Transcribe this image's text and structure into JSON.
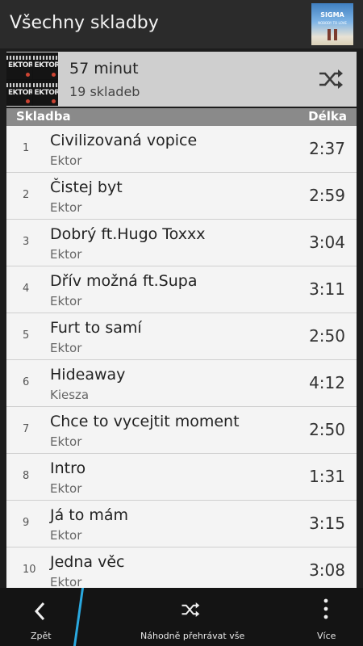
{
  "header": {
    "title": "Všechny skladby",
    "now_playing_art": {
      "brand": "SIGMA",
      "subtitle": "NOBODY TO LOVE",
      "icon": "album-cover"
    }
  },
  "summary": {
    "album_art_text": "EKTOR",
    "duration": "57 minut",
    "track_count": "19 skladeb",
    "shuffle_icon": "shuffle-icon"
  },
  "columns": {
    "track": "Skladba",
    "length": "Délka"
  },
  "tracks": [
    {
      "num": "1",
      "name": "Civilizovaná vopice",
      "artist": "Ektor",
      "length": "2:37"
    },
    {
      "num": "2",
      "name": "Čistej byt",
      "artist": "Ektor",
      "length": "2:59"
    },
    {
      "num": "3",
      "name": "Dobrý ft.Hugo Toxxx",
      "artist": "Ektor",
      "length": "3:04"
    },
    {
      "num": "4",
      "name": "Dřív možná ft.Supa",
      "artist": "Ektor",
      "length": "3:11"
    },
    {
      "num": "5",
      "name": "Furt to samí",
      "artist": "Ektor",
      "length": "2:50"
    },
    {
      "num": "6",
      "name": "Hideaway",
      "artist": "Kiesza",
      "length": "4:12"
    },
    {
      "num": "7",
      "name": "Chce to vycejtit moment",
      "artist": "Ektor",
      "length": "2:50"
    },
    {
      "num": "8",
      "name": "Intro",
      "artist": "Ektor",
      "length": "1:31"
    },
    {
      "num": "9",
      "name": "Já to mám",
      "artist": "Ektor",
      "length": "3:15"
    },
    {
      "num": "10",
      "name": "Jedna věc",
      "artist": "Ektor",
      "length": "3:08"
    }
  ],
  "actionbar": {
    "back_label": "Zpět",
    "shuffle_all_label": "Náhodně přehrávat vše",
    "more_label": "Více"
  },
  "colors": {
    "accent": "#2aa9e0",
    "header_bg": "#2b2b2b",
    "list_bg": "#f4f4f4",
    "column_header_bg": "#8a8a8a"
  }
}
